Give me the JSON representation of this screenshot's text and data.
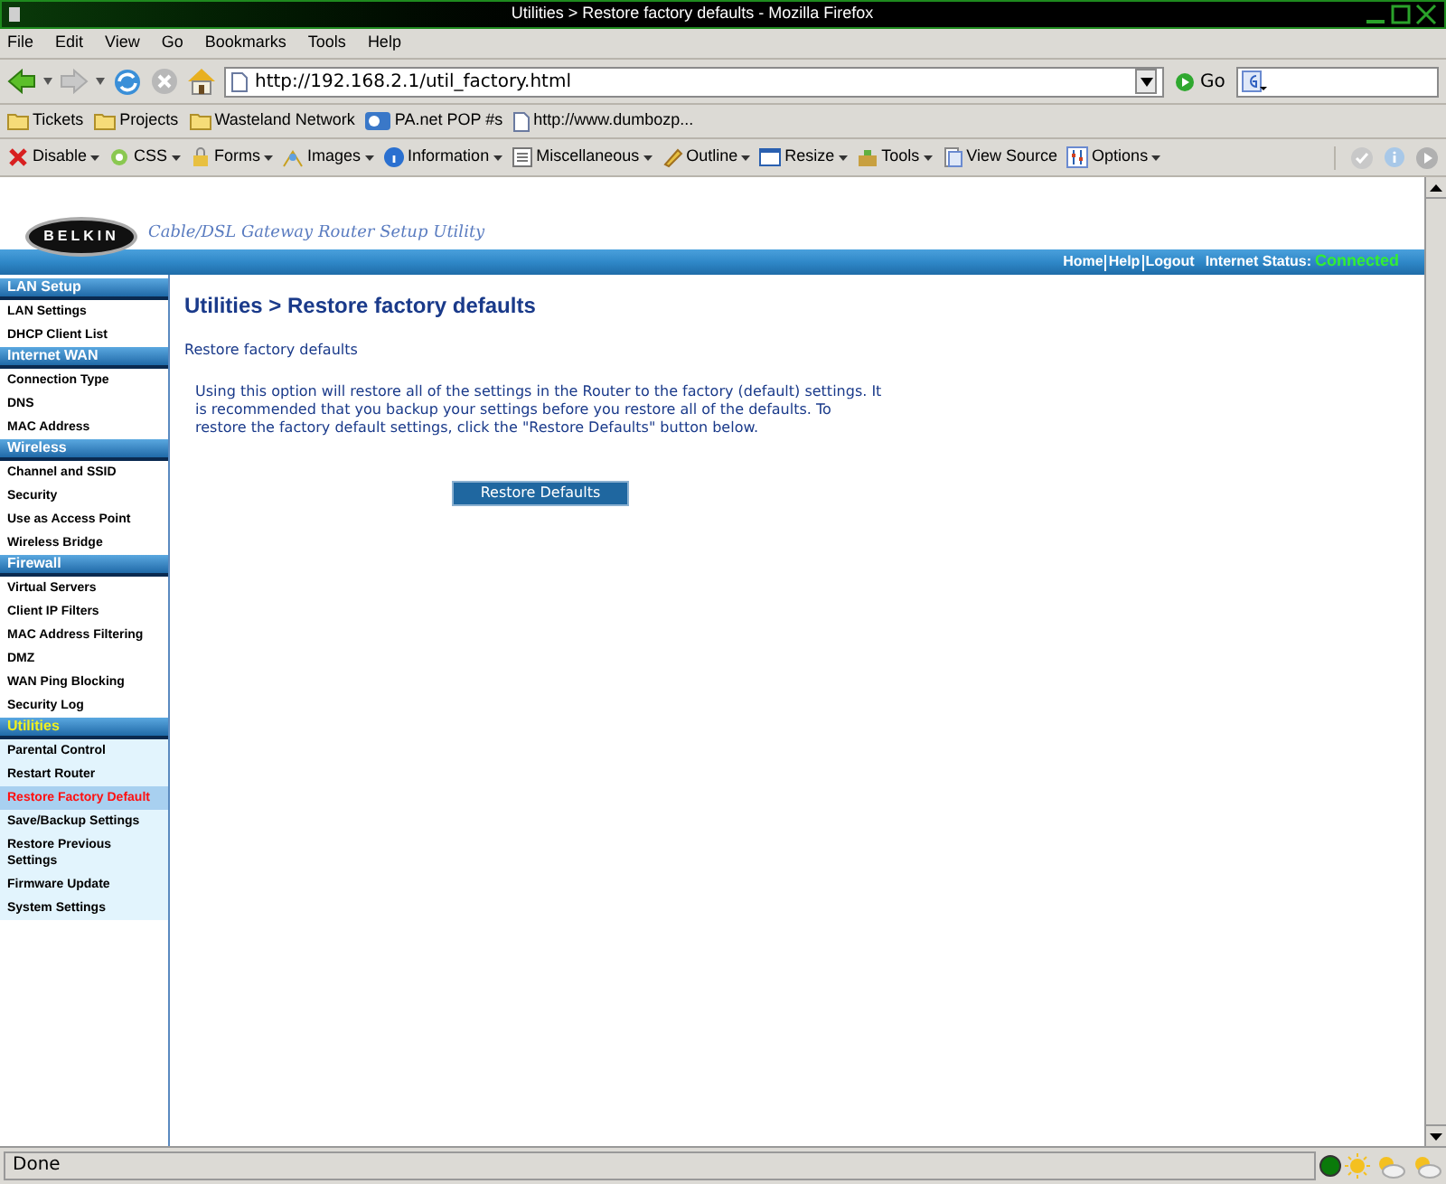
{
  "window": {
    "title": "Utilities > Restore factory defaults - Mozilla Firefox"
  },
  "menu": [
    "File",
    "Edit",
    "View",
    "Go",
    "Bookmarks",
    "Tools",
    "Help"
  ],
  "address": {
    "value": "http://192.168.2.1/util_factory.html"
  },
  "go_button": "Go",
  "bookmarks": [
    {
      "label": "Tickets",
      "kind": "folder"
    },
    {
      "label": "Projects",
      "kind": "folder"
    },
    {
      "label": "Wasteland Network",
      "kind": "folder"
    },
    {
      "label": "PA.net POP #s",
      "kind": "site"
    },
    {
      "label": "http://www.dumbozp...",
      "kind": "page"
    }
  ],
  "devtools": [
    {
      "label": "Disable",
      "kind": "disable"
    },
    {
      "label": "CSS",
      "kind": "css"
    },
    {
      "label": "Forms",
      "kind": "forms"
    },
    {
      "label": "Images",
      "kind": "images"
    },
    {
      "label": "Information",
      "kind": "info"
    },
    {
      "label": "Miscellaneous",
      "kind": "misc"
    },
    {
      "label": "Outline",
      "kind": "outline"
    },
    {
      "label": "Resize",
      "kind": "resize"
    },
    {
      "label": "Tools",
      "kind": "tools"
    },
    {
      "label": "View Source",
      "kind": "source"
    },
    {
      "label": "Options",
      "kind": "options"
    }
  ],
  "header": {
    "logo": "BELKIN",
    "tagline": "Cable/DSL Gateway Router Setup Utility",
    "links": [
      "Home",
      "Help",
      "Logout"
    ],
    "status_label": "Internet Status:",
    "status_value": "Connected"
  },
  "sidebar": [
    {
      "title": "LAN Setup",
      "active": false,
      "items": [
        {
          "label": "LAN Settings",
          "selected": false
        },
        {
          "label": "DHCP Client List",
          "selected": false
        }
      ]
    },
    {
      "title": "Internet WAN",
      "active": false,
      "items": [
        {
          "label": "Connection Type",
          "selected": false
        },
        {
          "label": "DNS",
          "selected": false
        },
        {
          "label": "MAC Address",
          "selected": false
        }
      ]
    },
    {
      "title": "Wireless",
      "active": false,
      "items": [
        {
          "label": "Channel and SSID",
          "selected": false
        },
        {
          "label": "Security",
          "selected": false
        },
        {
          "label": "Use as Access Point",
          "selected": false
        },
        {
          "label": "Wireless Bridge",
          "selected": false
        }
      ]
    },
    {
      "title": "Firewall",
      "active": false,
      "items": [
        {
          "label": "Virtual Servers",
          "selected": false
        },
        {
          "label": "Client IP Filters",
          "selected": false
        },
        {
          "label": "MAC Address Filtering",
          "selected": false
        },
        {
          "label": "DMZ",
          "selected": false
        },
        {
          "label": "WAN Ping Blocking",
          "selected": false
        },
        {
          "label": "Security Log",
          "selected": false
        }
      ]
    },
    {
      "title": "Utilities",
      "active": true,
      "items": [
        {
          "label": "Parental Control",
          "selected": false
        },
        {
          "label": "Restart Router",
          "selected": false
        },
        {
          "label": "Restore Factory Default",
          "selected": true
        },
        {
          "label": "Save/Backup Settings",
          "selected": false
        },
        {
          "label": "Restore Previous Settings",
          "selected": false
        },
        {
          "label": "Firmware Update",
          "selected": false
        },
        {
          "label": "System Settings",
          "selected": false
        }
      ]
    }
  ],
  "content": {
    "heading": "Utilities > Restore factory defaults",
    "subheading": "Restore factory defaults",
    "description": "Using this option will restore all of the settings in the Router to the factory (default) settings. It is recommended that you backup your settings before you restore all of the defaults. To restore the factory default settings, click the \"Restore Defaults\" button below.",
    "button": "Restore Defaults"
  },
  "status_bar": {
    "text": "Done"
  }
}
